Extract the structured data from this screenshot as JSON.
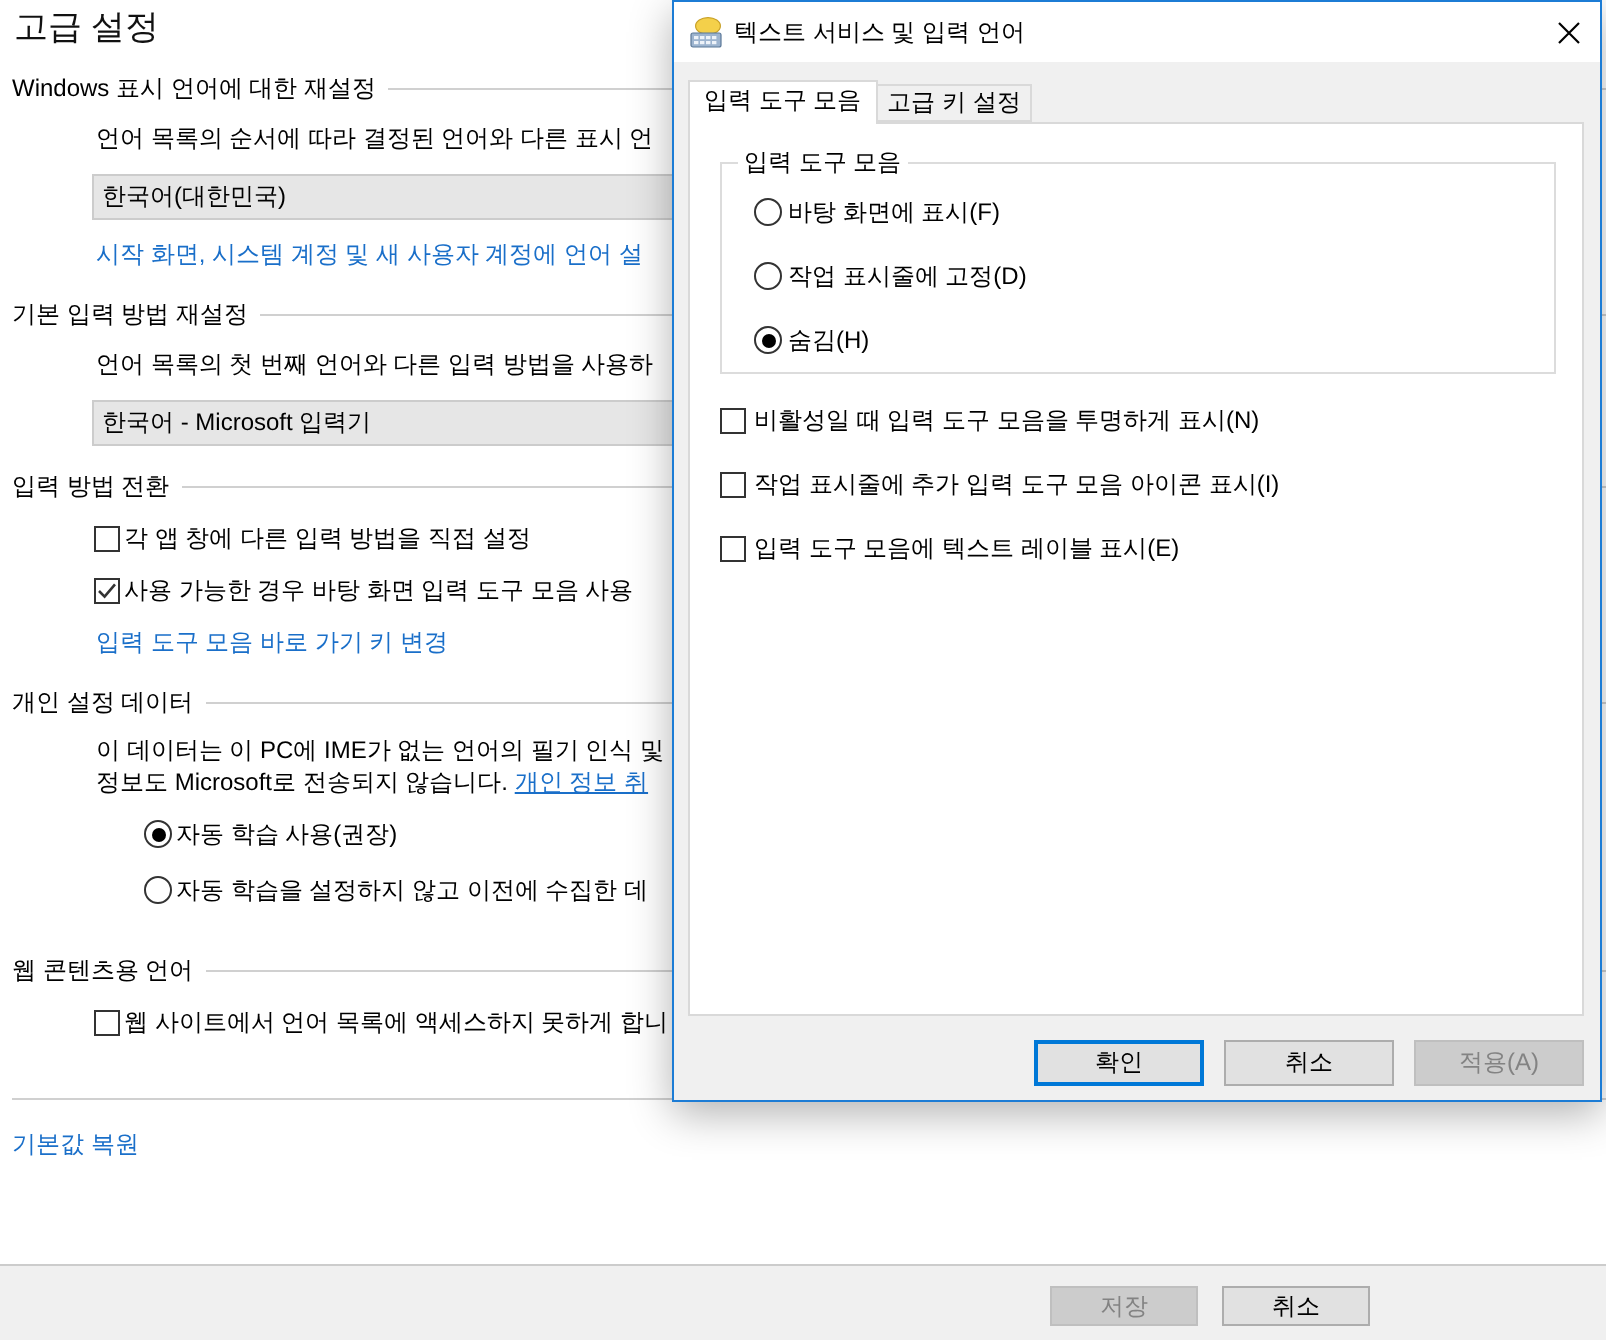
{
  "settings": {
    "title": "고급 설정",
    "sections": [
      {
        "heading": "Windows 표시 언어에 대한 재설정",
        "items": [
          {
            "kind": "text",
            "text": "언어 목록의 순서에 따라 결정된 언어와 다른 표시 언"
          },
          {
            "kind": "dropdown",
            "value": "한국어(대한민국)"
          },
          {
            "kind": "link",
            "text": "시작 화면, 시스템 계정 및 새 사용자 계정에 언어 설"
          }
        ]
      },
      {
        "heading": "기본 입력 방법 재설정",
        "items": [
          {
            "kind": "text",
            "text": "언어 목록의 첫 번째 언어와 다른 입력 방법을 사용하"
          },
          {
            "kind": "dropdown",
            "value": "한국어 - Microsoft 입력기"
          }
        ]
      },
      {
        "heading": "입력 방법 전환",
        "items": [
          {
            "kind": "checkbox",
            "label": "각 앱 창에 다른 입력 방법을 직접 설정",
            "checked": false
          },
          {
            "kind": "checkbox",
            "label": "사용 가능한 경우 바탕 화면 입력 도구 모음 사용",
            "checked": true
          },
          {
            "kind": "link",
            "text": "입력 도구 모음 바로 가기 키 변경"
          }
        ]
      },
      {
        "heading": "개인 설정 데이터",
        "items": [
          {
            "kind": "paragraph",
            "lines": [
              "이 데이터는 이 PC에 IME가 없는 언어의 필기 인식 및",
              "정보도 Microsoft로 전송되지 않습니다."
            ],
            "link": "개인 정보 취"
          },
          {
            "kind": "radio",
            "label": "자동 학습 사용(권장)",
            "selected": true
          },
          {
            "kind": "radio",
            "label": "자동 학습을 설정하지 않고 이전에 수집한 데",
            "selected": false
          }
        ]
      },
      {
        "heading": "웹 콘텐츠용 언어",
        "items": [
          {
            "kind": "checkbox",
            "label": "웹 사이트에서 언어 목록에 액세스하지 못하게 합니",
            "checked": false
          }
        ]
      }
    ],
    "restore_link": "기본값 복원",
    "buttons": [
      {
        "label": "저장",
        "disabled": true
      },
      {
        "label": "취소",
        "disabled": false
      }
    ]
  },
  "dialog": {
    "title": "텍스트 서비스 및 입력 언어",
    "tabs": [
      {
        "label": "입력 도구 모음",
        "selected": true
      },
      {
        "label": "고급 키 설정",
        "selected": false
      }
    ],
    "group": {
      "title": "입력 도구 모음",
      "options": [
        {
          "label": "바탕 화면에 표시(F)",
          "selected": false
        },
        {
          "label": "작업 표시줄에 고정(D)",
          "selected": false
        },
        {
          "label": "숨김(H)",
          "selected": true
        }
      ]
    },
    "checkboxes": [
      {
        "label": "비활성일 때 입력 도구 모음을 투명하게 표시(N)",
        "checked": false
      },
      {
        "label": "작업 표시줄에 추가 입력 도구 모음 아이콘 표시(I)",
        "checked": false
      },
      {
        "label": "입력 도구 모음에 텍스트 레이블 표시(E)",
        "checked": false
      }
    ],
    "buttons": [
      {
        "label": "확인",
        "focused": true,
        "disabled": false
      },
      {
        "label": "취소",
        "focused": false,
        "disabled": false
      },
      {
        "label": "적용(A)",
        "focused": false,
        "disabled": true
      }
    ]
  }
}
